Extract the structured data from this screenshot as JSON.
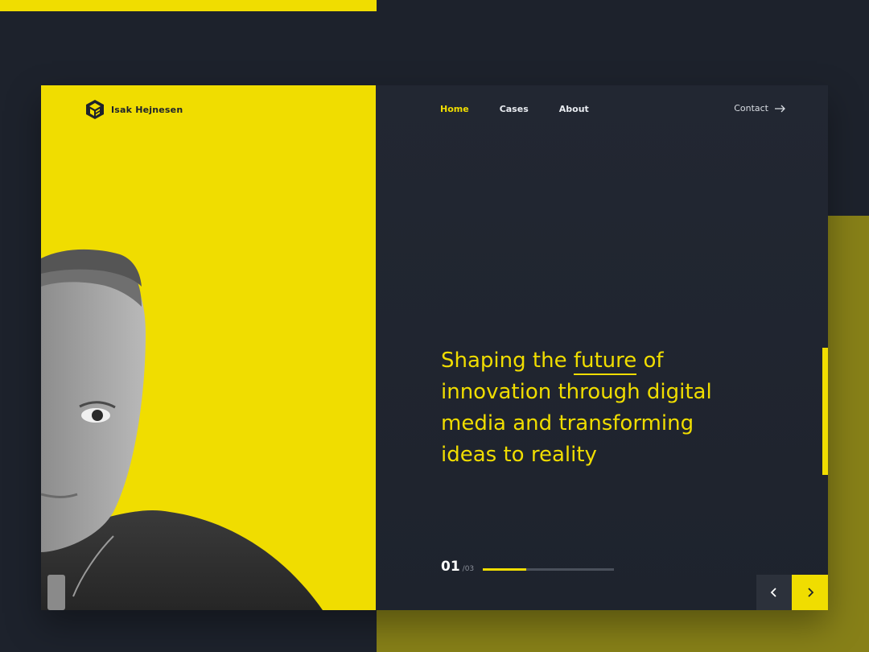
{
  "brand": {
    "name": "Isak Hejnesen"
  },
  "nav": {
    "items": [
      {
        "label": "Home",
        "active": true
      },
      {
        "label": "Cases",
        "active": false
      },
      {
        "label": "About",
        "active": false
      }
    ],
    "contact_label": "Contact"
  },
  "hero": {
    "line1_prefix": "Shaping the ",
    "line1_highlight": "future",
    "line1_suffix": " of",
    "line2": "innovation through digital",
    "line3": "media and transforming",
    "line4": "ideas to reality"
  },
  "slider": {
    "current": "01",
    "total": "/03",
    "progress_fraction": 0.333
  },
  "icons": {
    "logo": "cube-logo-icon",
    "contact": "arrow-right-icon",
    "prev": "chevron-left-icon",
    "next": "chevron-right-icon"
  },
  "colors": {
    "accent": "#f0dd00",
    "background": "#1d222c",
    "olive": "#878018"
  }
}
